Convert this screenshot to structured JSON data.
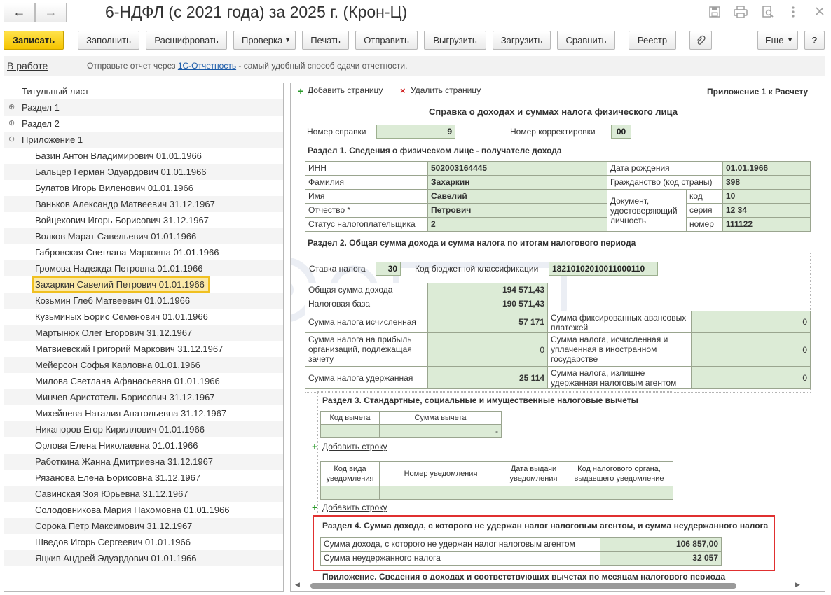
{
  "window": {
    "title": "6-НДФЛ (с 2021 года) за 2025 г. (Крон-Ц)",
    "back_glyph": "←",
    "forward_glyph": "→"
  },
  "toolbar": {
    "save": "Записать",
    "fill": "Заполнить",
    "decode": "Расшифровать",
    "check": "Проверка",
    "print": "Печать",
    "send": "Отправить",
    "export": "Выгрузить",
    "import": "Загрузить",
    "compare": "Сравнить",
    "registry": "Реестр",
    "more": "Еще",
    "help": "?"
  },
  "infobar": {
    "status": "В работе",
    "hint_before": "Отправьте отчет через ",
    "hint_link": "1С-Отчетность",
    "hint_after": " - самый удобный способ сдачи отчетности."
  },
  "tree": {
    "items": [
      "Титульный лист",
      "Раздел 1",
      "Раздел 2",
      "Приложение 1"
    ],
    "people": [
      "Базин Антон Владимирович 01.01.1966",
      "Бальцер Герман Эдуардович 01.01.1966",
      "Булатов Игорь Виленович 01.01.1966",
      "Ваньков Александр Матвеевич 31.12.1967",
      "Войцехович Игорь Борисович 31.12.1967",
      "Волков Марат Савельевич 01.01.1966",
      "Габровская Светлана Марковна 01.01.1966",
      "Громова Надежда Петровна 01.01.1966",
      "Захаркин Савелий Петрович 01.01.1966",
      "Козьмин Глеб Матвеевич 01.01.1966",
      "Кузьминых Борис Семенович 01.01.1966",
      "Мартынюк Олег Егорович 31.12.1967",
      "Матвиевский Григорий Маркович 31.12.1967",
      "Мейерсон Софья Карловна 01.01.1966",
      "Милова Светлана Афанасьевна 01.01.1966",
      "Минчев Аристотель Борисович 31.12.1967",
      "Михейцева Наталия Анатольевна 31.12.1967",
      "Никаноров Егор Кириллович 01.01.1966",
      "Орлова Елена Николаевна 01.01.1966",
      "Работкина Жанна Дмитриевна 31.12.1967",
      "Рязанова Елена Борисовна 31.12.1967",
      "Савинская Зоя Юрьевна 31.12.1967",
      "Солодовникова Мария Пахомовна 01.01.1966",
      "Сорока Петр Максимович 31.12.1967",
      "Шведов Игорь Сергеевич 01.01.1966",
      "Яцкив Андрей Эдуардович 01.01.1966"
    ],
    "selected": "Захаркин Савелий Петрович 01.01.1966"
  },
  "form": {
    "add_page": "Добавить страницу",
    "delete_page": "Удалить страницу",
    "appendix_label": "Приложение 1 к Расчету",
    "heading": "Справка о доходах и суммах налога физического лица",
    "cert_no_label": "Номер справки",
    "cert_no": "9",
    "corr_no_label": "Номер корректировки",
    "corr_no": "00",
    "section1": {
      "title": "Раздел 1. Сведения о физическом лице - получателе дохода",
      "inn_label": "ИНН",
      "inn": "502003164445",
      "surname_label": "Фамилия",
      "surname": "Захаркин",
      "name_label": "Имя",
      "name": "Савелий",
      "patronymic_label": "Отчество *",
      "patronymic": "Петрович",
      "status_label": "Статус налогоплательщика",
      "status": "2",
      "birth_label": "Дата рождения",
      "birth": "01.01.1966",
      "citizenship_label": "Гражданство (код страны)",
      "citizenship": "398",
      "doc_label": "Документ, удостоверяющий личность",
      "code_label": "код",
      "code": "10",
      "series_label": "серия",
      "series": "12 34",
      "number_label": "номер",
      "number": "111122"
    },
    "section2": {
      "title": "Раздел 2. Общая сумма дохода и сумма налога по итогам налогового периода",
      "rate_label": "Ставка налога",
      "rate": "30",
      "kbk_label": "Код бюджетной классификации",
      "kbk": "18210102010011000110",
      "total_income_label": "Общая сумма дохода",
      "total_income": "194 571,43",
      "tax_base_label": "Налоговая база",
      "tax_base": "190 571,43",
      "tax_calc_label": "Сумма налога исчисленная",
      "tax_calc": "57 171",
      "profit_label": "Сумма налога на прибыль организаций, подлежащая зачету",
      "profit": "0",
      "withheld_label": "Сумма налога удержанная",
      "withheld": "25 114",
      "fixed_label": "Сумма фиксированных авансовых платежей",
      "fixed": "0",
      "foreign_label": "Сумма налога, исчисленная и уплаченная в иностранном государстве",
      "foreign": "0",
      "excess_label": "Сумма налога, излишне удержанная налоговым агентом",
      "excess": "0"
    },
    "section3": {
      "title": "Раздел 3. Стандартные, социальные и имущественные налоговые вычеты",
      "col_code": "Код вычета",
      "col_sum": "Сумма вычета",
      "sum_value": "-",
      "add_row": "Добавить строку",
      "col_notice_code": "Код вида уведомления",
      "col_notice_no": "Номер уведомления",
      "col_notice_date": "Дата выдачи уведомления",
      "col_authority": "Код налогового органа, выдавшего уведомление",
      "add_row2": "Добавить строку"
    },
    "section4": {
      "title": "Раздел 4. Сумма дохода, с которого не удержан налог налоговым агентом, и сумма неудержанного налога",
      "income_label": "Сумма дохода, с которого не удержан налог налоговым агентом",
      "income": "106 857,00",
      "tax_label": "Сумма неудержанного налога",
      "tax": "32 057"
    },
    "appendix_title": "Приложение. Сведения о доходах и соответствующих вычетах по месяцам налогового периода"
  },
  "colors": {
    "save_button": "#f5c400",
    "highlight_border": "#e03030",
    "field_green": "#dcebd6",
    "link": "#1a5aa8"
  }
}
